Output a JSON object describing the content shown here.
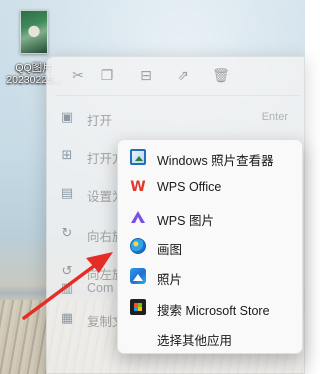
{
  "desktop": {
    "file_icon": {
      "label_line1": "QQ图片",
      "label_line2": "20230225..."
    }
  },
  "context_menu": {
    "toolbar": [
      "cut-icon",
      "copy-icon",
      "rename-icon",
      "share-icon",
      "delete-icon"
    ],
    "items": [
      {
        "icon": "open-icon",
        "label": "打开",
        "shortcut": "Enter"
      },
      {
        "icon": "open-with-icon",
        "label": "打开方式"
      },
      {
        "icon": "set-as-icon",
        "label": "设置为"
      },
      {
        "icon": "rotate-right-icon",
        "label": "向右旋转"
      },
      {
        "icon": "rotate-left-icon",
        "label": "向左旋转"
      },
      {
        "icon": "compress-icon",
        "label": "Com"
      },
      {
        "icon": "copy-path-icon",
        "label": "复制文件地址"
      }
    ]
  },
  "submenu": {
    "items": [
      {
        "icon": "windows-photo-viewer-icon",
        "label": "Windows 照片查看器"
      },
      {
        "icon": "wps-office-icon",
        "label": "WPS Office"
      },
      {
        "icon": "wps-picture-icon",
        "label": "WPS 图片"
      },
      {
        "icon": "paint-icon",
        "label": "画图"
      },
      {
        "icon": "photos-icon",
        "label": "照片"
      },
      {
        "icon": "microsoft-store-icon",
        "label": "搜索 Microsoft Store"
      },
      {
        "icon": "",
        "label": "选择其他应用"
      }
    ]
  },
  "colors": {
    "arrow": "#e52d27",
    "menu_bg": "#f9f9f9",
    "wps_red": "#e03a2f",
    "wps_picture_purple": "#7a4fe3"
  }
}
